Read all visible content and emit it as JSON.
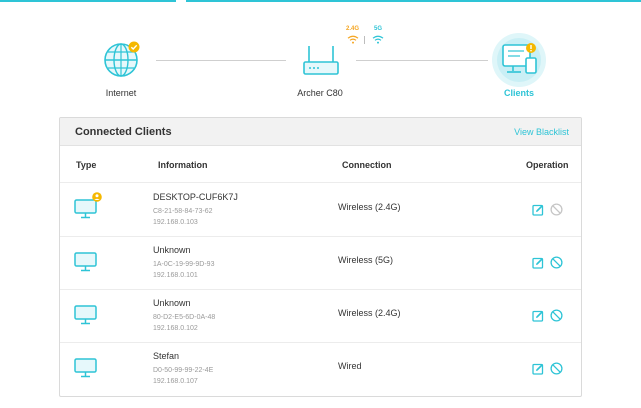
{
  "network_map": {
    "internet_label": "Internet",
    "router_label": "Archer C80",
    "clients_label": "Clients",
    "band_24": "2.4G",
    "band_5": "5G"
  },
  "clients_card": {
    "title": "Connected Clients",
    "view_blacklist": "View Blacklist",
    "columns": {
      "type": "Type",
      "information": "Information",
      "connection": "Connection",
      "operation": "Operation"
    },
    "rows": [
      {
        "name": "DESKTOP-CUF6K7J",
        "mac": "C8-21-58-84-73-62",
        "ip": "192.168.0.103",
        "connection": "Wireless (2.4G)",
        "current_device": true
      },
      {
        "name": "Unknown",
        "mac": "1A-0C-19-99-9D-93",
        "ip": "192.168.0.101",
        "connection": "Wireless (5G)",
        "current_device": false
      },
      {
        "name": "Unknown",
        "mac": "80-D2-E5-6D-0A-48",
        "ip": "192.168.0.102",
        "connection": "Wireless (2.4G)",
        "current_device": false
      },
      {
        "name": "Stefan",
        "mac": "D0-50-99-99-22-4E",
        "ip": "192.168.0.107",
        "connection": "Wired",
        "current_device": false
      }
    ]
  },
  "icons": {
    "internet": "globe-icon",
    "router": "router-icon",
    "clients": "clients-device-icon",
    "client_type": "monitor-icon",
    "edit": "edit-icon",
    "block": "block-icon",
    "current_user": "user-badge-icon"
  },
  "colors": {
    "accent": "#2ec4d6",
    "warning": "#f5a623",
    "line": "#cfcfcf"
  }
}
